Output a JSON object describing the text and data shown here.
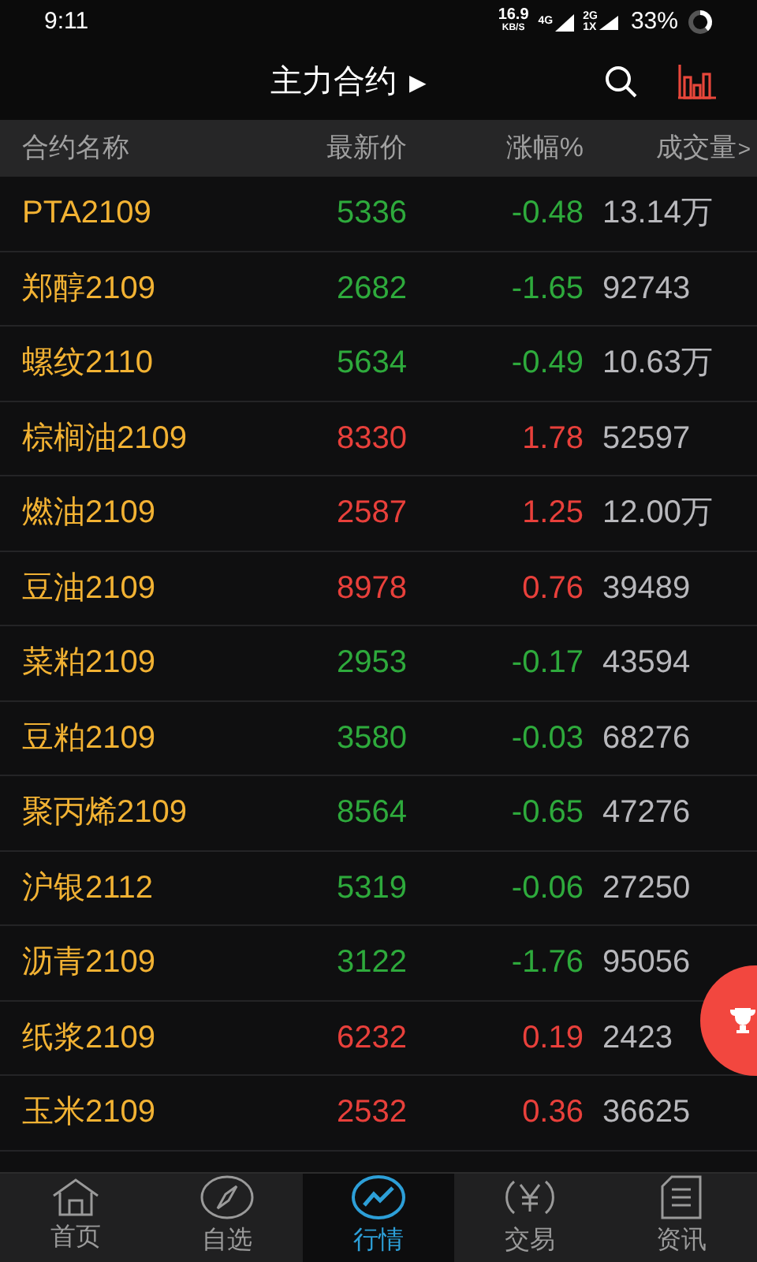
{
  "status_bar": {
    "time": "9:11",
    "speed": "16.9",
    "speed_unit": "KB/S",
    "network_1": "4G",
    "network_2": "2G",
    "network_2_sub": "1X",
    "battery": "33%"
  },
  "header": {
    "title": "主力合约",
    "title_caret": "▶"
  },
  "columns": [
    "合约名称",
    "最新价",
    "涨幅%",
    "成交量"
  ],
  "columns_more": ">",
  "rows": [
    {
      "name": "PTA2109",
      "price": "5336",
      "change": "-0.48",
      "volume": "13.14万",
      "kind": "down"
    },
    {
      "name": "郑醇2109",
      "price": "2682",
      "change": "-1.65",
      "volume": "92743",
      "kind": "down"
    },
    {
      "name": "螺纹2110",
      "price": "5634",
      "change": "-0.49",
      "volume": "10.63万",
      "kind": "down"
    },
    {
      "name": "棕榈油2109",
      "price": "8330",
      "change": "1.78",
      "volume": "52597",
      "kind": "up"
    },
    {
      "name": "燃油2109",
      "price": "2587",
      "change": "1.25",
      "volume": "12.00万",
      "kind": "up"
    },
    {
      "name": "豆油2109",
      "price": "8978",
      "change": "0.76",
      "volume": "39489",
      "kind": "up"
    },
    {
      "name": "菜粕2109",
      "price": "2953",
      "change": "-0.17",
      "volume": "43594",
      "kind": "down"
    },
    {
      "name": "豆粕2109",
      "price": "3580",
      "change": "-0.03",
      "volume": "68276",
      "kind": "down"
    },
    {
      "name": "聚丙烯2109",
      "price": "8564",
      "change": "-0.65",
      "volume": "47276",
      "kind": "down"
    },
    {
      "name": "沪银2112",
      "price": "5319",
      "change": "-0.06",
      "volume": "27250",
      "kind": "down"
    },
    {
      "name": "沥青2109",
      "price": "3122",
      "change": "-1.76",
      "volume": "95056",
      "kind": "down"
    },
    {
      "name": "纸浆2109",
      "price": "6232",
      "change": "0.19",
      "volume": "2423",
      "kind": "up"
    },
    {
      "name": "玉米2109",
      "price": "2532",
      "change": "0.36",
      "volume": "36625",
      "kind": "up"
    }
  ],
  "nav": [
    {
      "label": "首页",
      "selected": false
    },
    {
      "label": "自选",
      "selected": false
    },
    {
      "label": "行情",
      "selected": true
    },
    {
      "label": "交易",
      "selected": false
    },
    {
      "label": "资讯",
      "selected": false
    }
  ]
}
